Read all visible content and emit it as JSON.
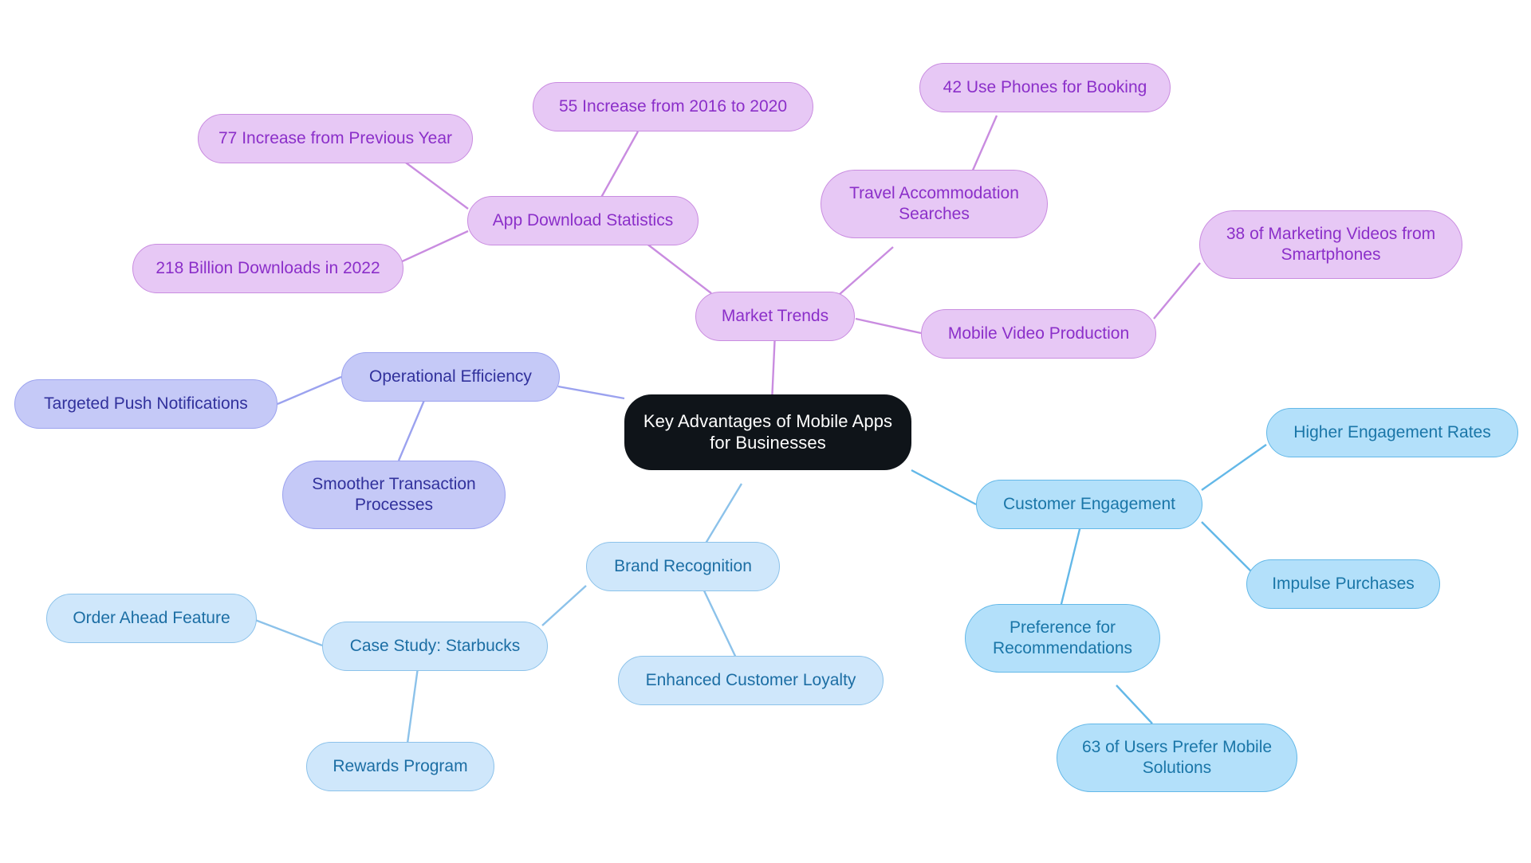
{
  "diagram": {
    "type": "mind-map",
    "title": "Key Advantages of Mobile Apps for Businesses",
    "background": "#ffffff",
    "palettes": {
      "root_fill": "#0f1419",
      "root_text": "#ffffff",
      "purple_fill": "#e7c8f5",
      "purple_stroke": "#c98ce0",
      "purple_text": "#8b2fc9",
      "periwinkle_fill": "#c5c9f7",
      "periwinkle_stroke": "#9ba2ef",
      "periwinkle_text": "#31319c",
      "skyblue_fill": "#b3e0fa",
      "skyblue_stroke": "#63b8e8",
      "skyblue_text": "#1a76a8",
      "paleblue_fill": "#cfe7fb",
      "paleblue_stroke": "#8cc2ea",
      "paleblue_text": "#1c6ea4"
    }
  },
  "nodes": {
    "root": {
      "label": "Key Advantages of Mobile Apps\nfor Businesses"
    },
    "market_trends": {
      "label": "Market Trends"
    },
    "app_download_statistics": {
      "label": "App Download Statistics"
    },
    "increase_previous_year": {
      "label": "77 Increase from Previous Year"
    },
    "increase_2016_2020": {
      "label": "55 Increase from 2016 to 2020"
    },
    "billion_downloads_2022": {
      "label": "218 Billion Downloads in 2022"
    },
    "travel_accommodation_searches": {
      "label": "Travel Accommodation\nSearches"
    },
    "use_phones_booking": {
      "label": "42 Use Phones for Booking"
    },
    "mobile_video_production": {
      "label": "Mobile Video Production"
    },
    "marketing_videos_smartphones": {
      "label": "38 of Marketing Videos from\nSmartphones"
    },
    "operational_efficiency": {
      "label": "Operational Efficiency"
    },
    "targeted_push_notifications": {
      "label": "Targeted Push Notifications"
    },
    "smoother_transaction_processes": {
      "label": "Smoother Transaction\nProcesses"
    },
    "customer_engagement": {
      "label": "Customer Engagement"
    },
    "higher_engagement_rates": {
      "label": "Higher Engagement Rates"
    },
    "impulse_purchases": {
      "label": "Impulse Purchases"
    },
    "preference_recommendations": {
      "label": "Preference for\nRecommendations"
    },
    "users_prefer_mobile": {
      "label": "63 of Users Prefer Mobile\nSolutions"
    },
    "brand_recognition": {
      "label": "Brand Recognition"
    },
    "enhanced_customer_loyalty": {
      "label": "Enhanced Customer Loyalty"
    },
    "case_study_starbucks": {
      "label": "Case Study: Starbucks"
    },
    "order_ahead_feature": {
      "label": "Order Ahead Feature"
    },
    "rewards_program": {
      "label": "Rewards Program"
    }
  }
}
